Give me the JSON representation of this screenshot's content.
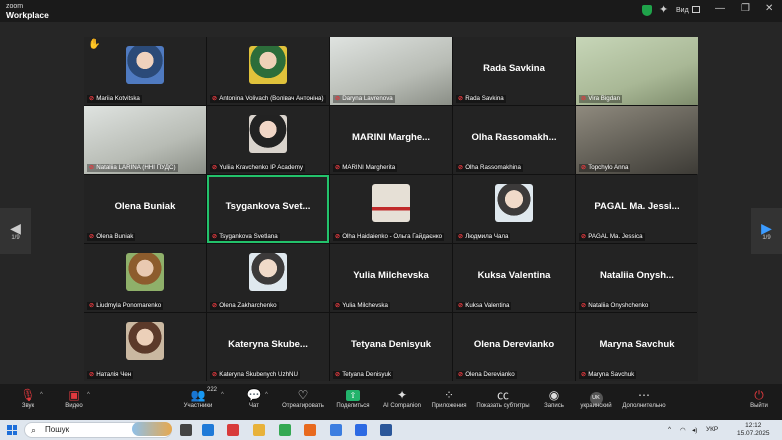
{
  "titlebar": {
    "logo_line1": "zoom",
    "logo_line2": "Workplace",
    "view_label": "Вид",
    "minimize": "—",
    "maximize": "❐",
    "close": "✕"
  },
  "pager": {
    "left_label": "1/9",
    "right_label": "1/9"
  },
  "tiles": [
    {
      "tag": "Mariia Kotvitska",
      "big": "",
      "kind": "avatar",
      "style": "blue",
      "hand": "✋"
    },
    {
      "tag": "Antonina Volivach (Волівач Антоніна)",
      "big": "",
      "kind": "avatar",
      "style": "gold"
    },
    {
      "tag": "Daryna Lavrenova",
      "big": "",
      "kind": "video",
      "style": "light"
    },
    {
      "tag": "Rada Savkina",
      "big": "Rada Savkina",
      "kind": "name"
    },
    {
      "tag": "Vira Bigdan",
      "big": "",
      "kind": "video",
      "style": "green"
    },
    {
      "tag": "Nataliia LARINA (ННІ ПУДС)",
      "big": "",
      "kind": "video",
      "style": "light"
    },
    {
      "tag": "Yuliia Kravchenko IP Academy",
      "big": "",
      "kind": "avatar",
      "style": "dark"
    },
    {
      "tag": "MARINI Margherita",
      "big": "MARINI  Marghe...",
      "kind": "name"
    },
    {
      "tag": "Olha Rassomakhina",
      "big": "Olha  Rassomakh...",
      "kind": "name"
    },
    {
      "tag": "Topchylo Anna",
      "big": "",
      "kind": "video",
      "style": ""
    },
    {
      "tag": "Olena Buniak",
      "big": "Olena Buniak",
      "kind": "name"
    },
    {
      "tag": "Tsygankova Svetlana",
      "big": "Tsygankova  Svet...",
      "kind": "name",
      "active": true
    },
    {
      "tag": "Olha Haidaienko - Ольга Гайдаєнко",
      "big": "",
      "kind": "avatar",
      "style": "flag"
    },
    {
      "tag": "Людмила Чала",
      "big": "",
      "kind": "avatar",
      "style": "pale"
    },
    {
      "tag": "PAGAL Ma. Jessica",
      "big": "PAGAL  Ma. Jessi...",
      "kind": "name"
    },
    {
      "tag": "Liudmyla Ponomarenko",
      "big": "",
      "kind": "avatar",
      "style": "field"
    },
    {
      "tag": "Olena Zakharchenko",
      "big": "",
      "kind": "avatar",
      "style": "pale"
    },
    {
      "tag": "Yulia Milchevska",
      "big": "Yulia Milchevska",
      "kind": "name"
    },
    {
      "tag": "Kuksa Valentina",
      "big": "Kuksa Valentina",
      "kind": "name"
    },
    {
      "tag": "Nataliia Onyshchenko",
      "big": "Nataliia  Onysh...",
      "kind": "name"
    },
    {
      "tag": "Наталія Чен",
      "big": "",
      "kind": "avatar",
      "style": "room"
    },
    {
      "tag": "Kateryna Skubenych UzhNU",
      "big": "Kateryna  Skube...",
      "kind": "name"
    },
    {
      "tag": "Tetyana Denisyuk",
      "big": "Tetyana Denisyuk",
      "kind": "name"
    },
    {
      "tag": "Olena Derevianko",
      "big": "Olena Derevianko",
      "kind": "name"
    },
    {
      "tag": "Maryna Savchuk",
      "big": "Maryna Savchuk",
      "kind": "name"
    }
  ],
  "toolbar": {
    "audio": "Звук",
    "video": "Видео",
    "participants": "Участники",
    "participants_count": "222",
    "chat": "Чат",
    "react": "Отреагировать",
    "share": "Поделиться",
    "ai": "AI Companion",
    "apps": "Приложения",
    "captions": "Показать субтитры",
    "record": "Запись",
    "language": "украинский",
    "language_code": "UK",
    "more": "Дополнительно",
    "leave": "Выйти"
  },
  "taskbar": {
    "search_label": "Пошук",
    "lang": "УКР",
    "time": "12:12",
    "date": "15.07.2025"
  }
}
